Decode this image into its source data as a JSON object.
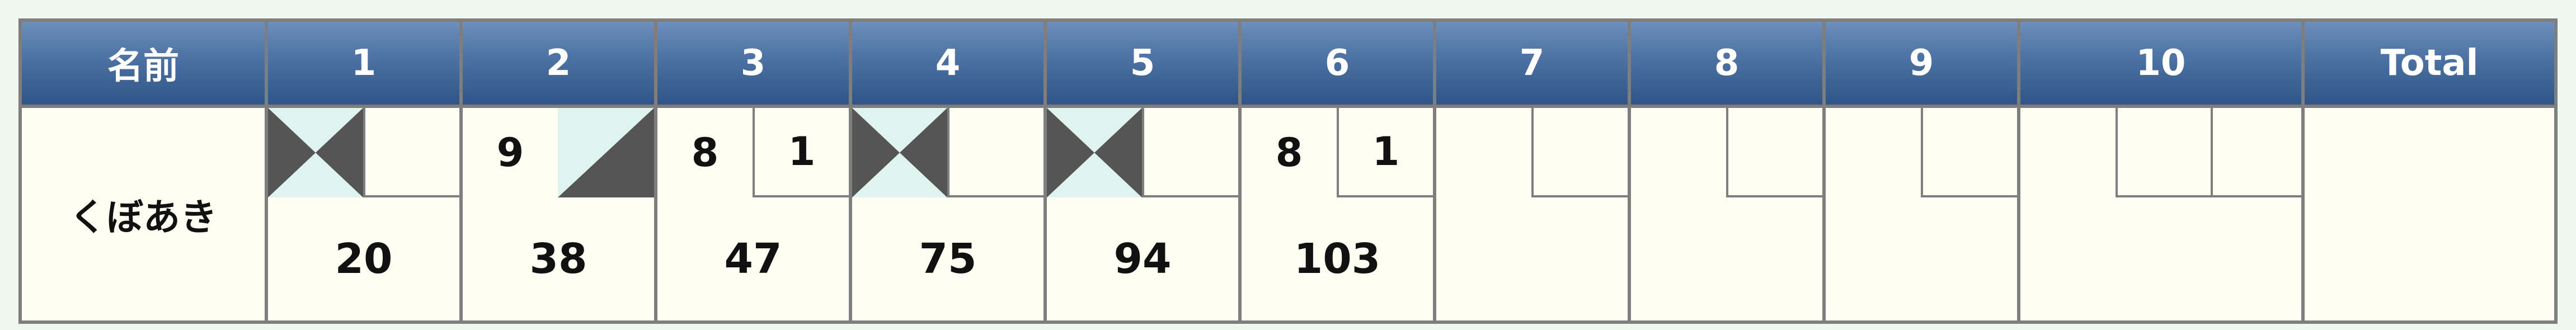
{
  "header": {
    "name_label": "名前",
    "frames": [
      "1",
      "2",
      "3",
      "4",
      "5",
      "6",
      "7",
      "8",
      "9",
      "10"
    ],
    "total_label": "Total"
  },
  "player": {
    "name": "くぼあき",
    "frames": [
      {
        "ball1": "",
        "ball2": "",
        "mark": "strike",
        "cumulative": "20"
      },
      {
        "ball1": "9",
        "ball2": "",
        "mark": "spare",
        "cumulative": "38"
      },
      {
        "ball1": "8",
        "ball2": "1",
        "mark": "open",
        "cumulative": "47"
      },
      {
        "ball1": "",
        "ball2": "",
        "mark": "strike",
        "cumulative": "75"
      },
      {
        "ball1": "",
        "ball2": "",
        "mark": "strike",
        "cumulative": "94"
      },
      {
        "ball1": "8",
        "ball2": "1",
        "mark": "open",
        "cumulative": "103"
      },
      {
        "ball1": "",
        "ball2": "",
        "mark": "empty",
        "cumulative": ""
      },
      {
        "ball1": "",
        "ball2": "",
        "mark": "empty",
        "cumulative": ""
      },
      {
        "ball1": "",
        "ball2": "",
        "mark": "empty",
        "cumulative": ""
      },
      {
        "ball1": "",
        "ball2": "",
        "ball3": "",
        "mark": "empty",
        "cumulative": ""
      }
    ],
    "total": ""
  },
  "colors": {
    "header_top": "#6c8fbc",
    "header_bottom": "#2f5487",
    "mark_dark": "#555555",
    "mark_light": "#dff4ee",
    "cell_bg": "#fefff2",
    "border": "#7e7e7e"
  }
}
